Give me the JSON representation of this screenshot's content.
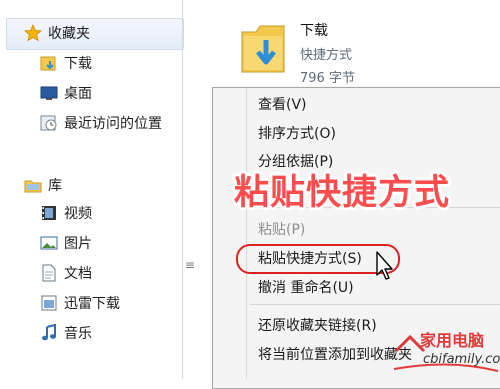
{
  "nav": {
    "favorites": "收藏夹",
    "downloads": "下载",
    "desktop": "桌面",
    "recent": "最近访问的位置",
    "library": "库",
    "videos": "视频",
    "pictures": "图片",
    "documents": "文档",
    "thunder": "迅雷下载",
    "music": "音乐"
  },
  "file": {
    "name": "下载",
    "type": "快捷方式",
    "size": "796 字节"
  },
  "context_menu": {
    "view": "查看(V)",
    "sort": "排序方式(O)",
    "group": "分组依据(P)",
    "paste": "粘贴(P)",
    "paste_shortcut": "粘贴快捷方式(S)",
    "undo_rename": "撤消 重命名(U)",
    "restore_favorites": "还原收藏夹链接(R)",
    "add_current": "将当前位置添加到收藏夹"
  },
  "overlay_title": "粘贴快捷方式",
  "watermark": {
    "title": "家用电脑",
    "site": "cbifamily.com"
  },
  "colors": {
    "overlay": "#ff4d4d",
    "highlight_ring": "#dd2222",
    "folder": "#f2c94c",
    "arrow": "#2f8fd6"
  }
}
